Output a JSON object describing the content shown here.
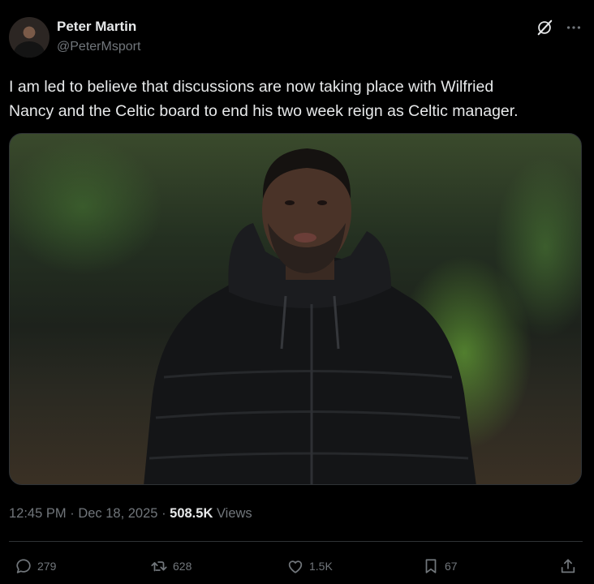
{
  "author": {
    "name": "Peter Martin",
    "handle": "@PeterMsport"
  },
  "tweet": {
    "text": "I am led to believe that discussions are now taking place with Wilfried\nNancy and the Celtic board to end his two week reign as Celtic manager."
  },
  "meta": {
    "time": "12:45 PM",
    "separator": "·",
    "date": "Dec 18, 2025",
    "views_count": "508.5K",
    "views_label": "Views"
  },
  "actions": {
    "replies": "279",
    "reposts": "628",
    "likes": "1.5K",
    "bookmarks": "67"
  },
  "icons": {
    "grok": "grok-icon",
    "more": "more-icon",
    "reply": "reply-icon",
    "repost": "repost-icon",
    "like": "heart-icon",
    "bookmark": "bookmark-icon",
    "share": "share-icon"
  },
  "colors": {
    "background": "#000000",
    "text": "#e7e9ea",
    "secondary": "#71767b",
    "border": "#2f3336"
  }
}
